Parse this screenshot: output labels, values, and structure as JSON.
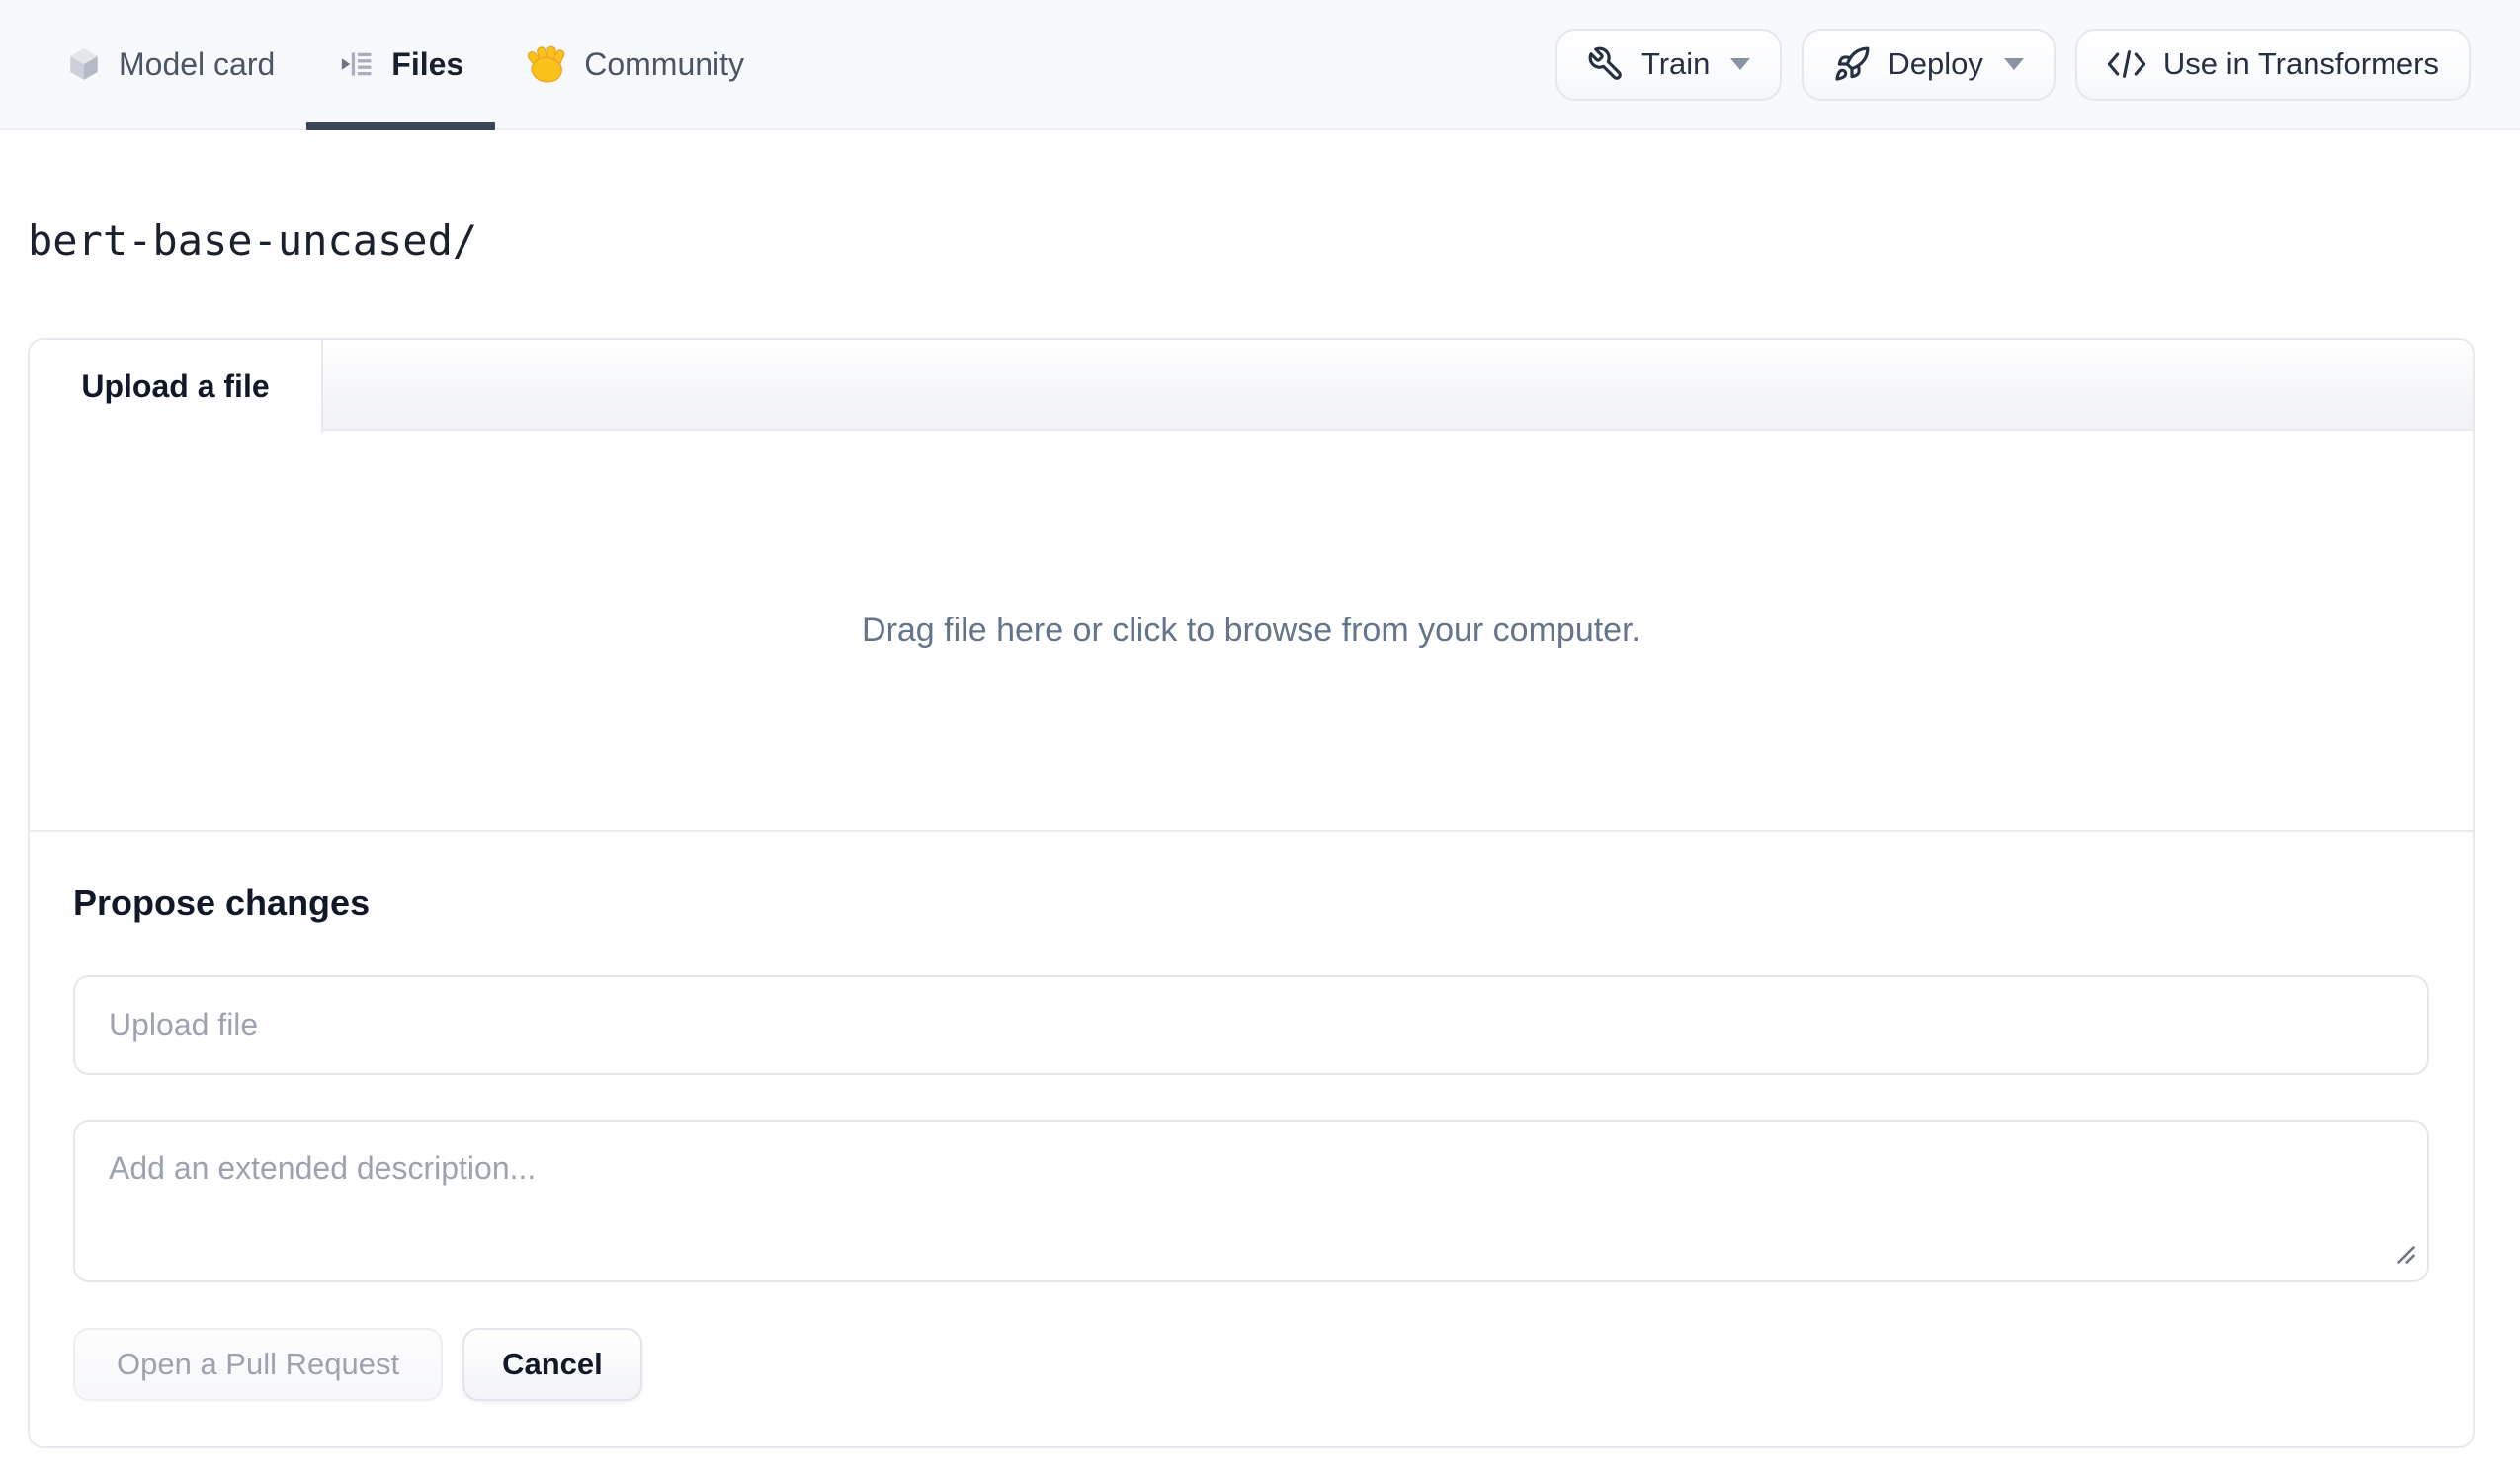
{
  "topnav": {
    "tabs": [
      {
        "label": "Model card",
        "icon": "cube-icon",
        "active": false
      },
      {
        "label": "Files",
        "icon": "files-list-icon",
        "active": true
      },
      {
        "label": "Community",
        "icon": "waving-hand-icon",
        "active": false
      }
    ],
    "actions": [
      {
        "label": "Train",
        "icon": "wrench-icon",
        "has_caret": true
      },
      {
        "label": "Deploy",
        "icon": "rocket-icon",
        "has_caret": true
      },
      {
        "label": "Use in Transformers",
        "icon": "code-icon",
        "has_caret": false
      }
    ]
  },
  "breadcrumb": {
    "path": "bert-base-uncased/"
  },
  "upload_panel": {
    "tab_label": "Upload a file",
    "dropzone_text": "Drag file here or click to browse from your computer.",
    "propose": {
      "heading": "Propose changes",
      "filename_placeholder": "Upload file",
      "filename_value": "",
      "description_placeholder": "Add an extended description...",
      "description_value": "",
      "primary_button": "Open a Pull Request",
      "primary_button_state": "disabled",
      "cancel_button": "Cancel"
    }
  },
  "colors": {
    "topbar_bg": "#f8f9fc",
    "active_tab_underline": "#3a4557",
    "muted_text": "#64748b",
    "placeholder_text": "#9ca3af",
    "border": "#e5e7eb",
    "hand_emoji_yellow": "#fcc21c"
  }
}
